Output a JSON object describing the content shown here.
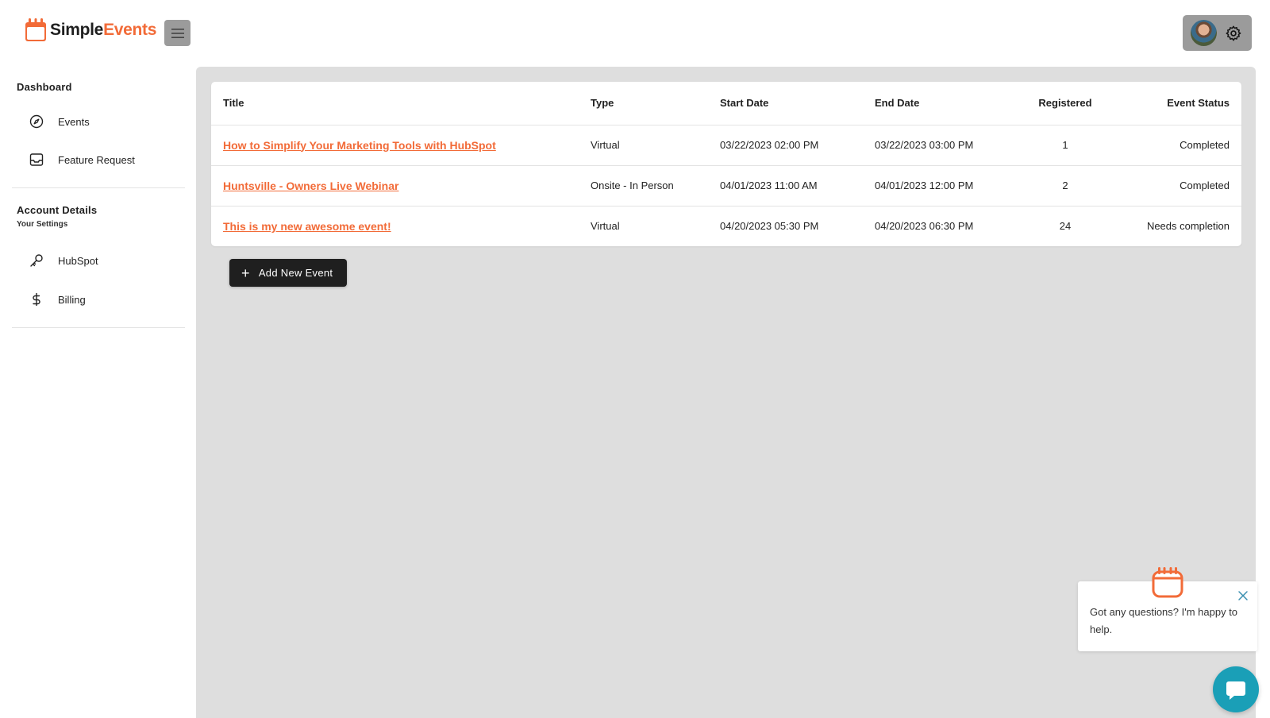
{
  "app": {
    "logo_text_part1": "Simple",
    "logo_text_part2": "Events",
    "brand_color": "#f26b38"
  },
  "header": {
    "menu_icon": "hamburger-menu-icon",
    "settings_icon": "gear-icon"
  },
  "sidebar": {
    "section1_title": "Dashboard",
    "items1": [
      {
        "label": "Events",
        "icon": "compass-icon"
      },
      {
        "label": "Feature Request",
        "icon": "inbox-icon"
      }
    ],
    "section2_title": "Account Details",
    "section2_subtitle": "Your Settings",
    "items2": [
      {
        "label": "HubSpot",
        "icon": "key-icon"
      },
      {
        "label": "Billing",
        "icon": "dollar-icon"
      }
    ]
  },
  "table": {
    "columns": [
      "Title",
      "Type",
      "Start Date",
      "End Date",
      "Registered",
      "Event Status"
    ],
    "rows": [
      {
        "title": "How to Simplify Your Marketing Tools with HubSpot",
        "type": "Virtual",
        "start": "03/22/2023 02:00 PM",
        "end": "03/22/2023 03:00 PM",
        "registered": "1",
        "status": "Completed"
      },
      {
        "title": "Huntsville - Owners Live Webinar",
        "type": "Onsite - In Person",
        "start": "04/01/2023 11:00 AM",
        "end": "04/01/2023 12:00 PM",
        "registered": "2",
        "status": "Completed"
      },
      {
        "title": "This is my new awesome event!",
        "type": "Virtual",
        "start": "04/20/2023 05:30 PM",
        "end": "04/20/2023 06:30 PM",
        "registered": "24",
        "status": "Needs completion"
      }
    ]
  },
  "actions": {
    "add_event_label": "Add New Event"
  },
  "chat": {
    "message": "Got any questions? I'm happy to help.",
    "launcher_color": "#1a9fb7"
  }
}
